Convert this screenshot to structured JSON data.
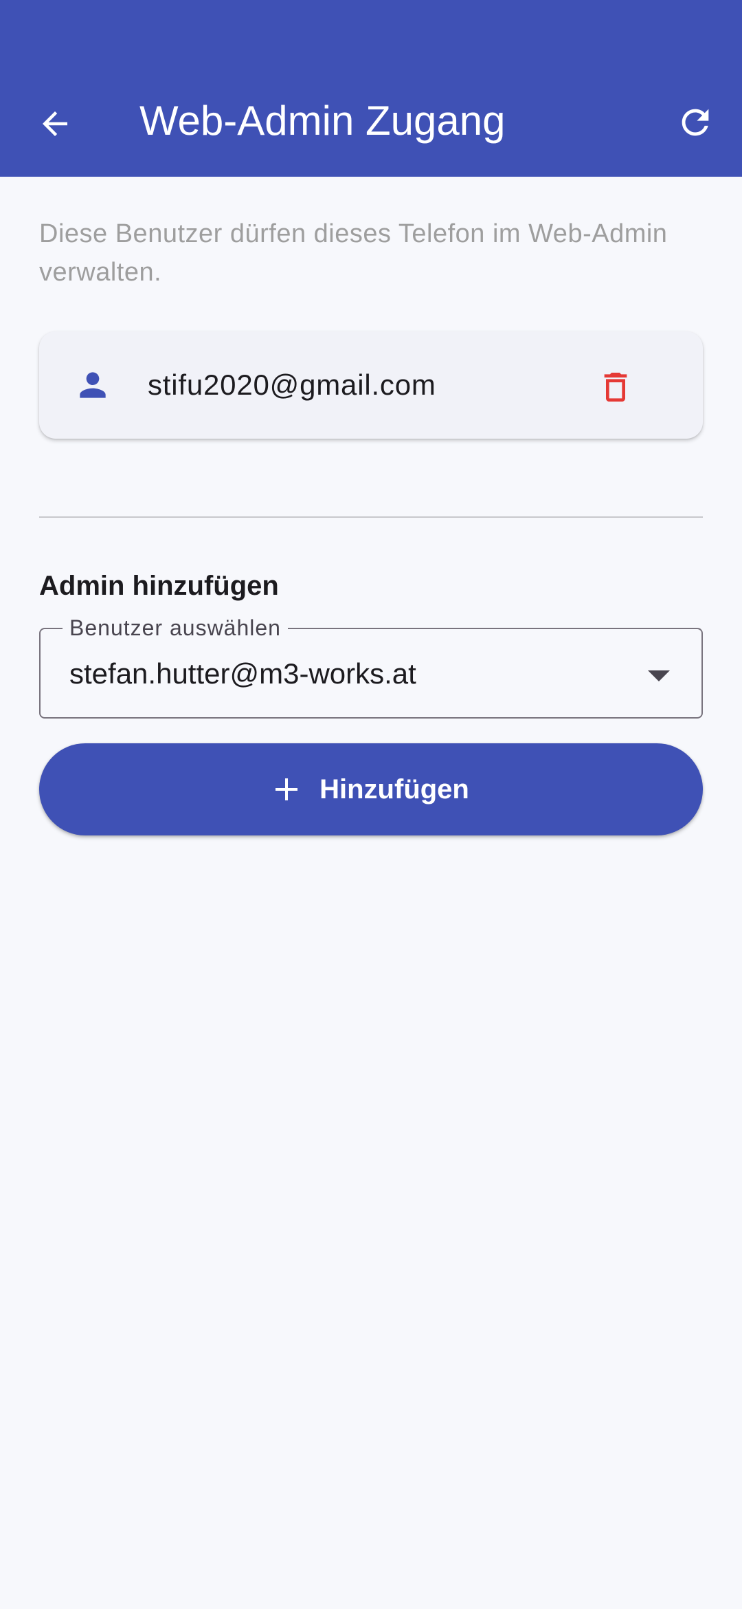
{
  "app_bar": {
    "title": "Web-Admin Zugang",
    "background_color": "#3f51b5",
    "back_icon": "arrow-back-icon",
    "refresh_icon": "refresh-icon"
  },
  "description": "Diese Benutzer dürfen dieses Telefon im Web-Admin verwalten.",
  "admins": [
    {
      "email": "stifu2020@gmail.com",
      "icon": "person-icon",
      "action_icon": "delete-icon",
      "icon_color": "#3f51b5",
      "action_color": "#e53935"
    }
  ],
  "add_section": {
    "title": "Admin hinzufügen",
    "select_label": "Benutzer auswählen",
    "selected_value": "stefan.hutter@m3-works.at",
    "button_label": "Hinzufügen",
    "button_icon": "plus-icon",
    "dropdown_icon": "dropdown-arrow-icon"
  }
}
